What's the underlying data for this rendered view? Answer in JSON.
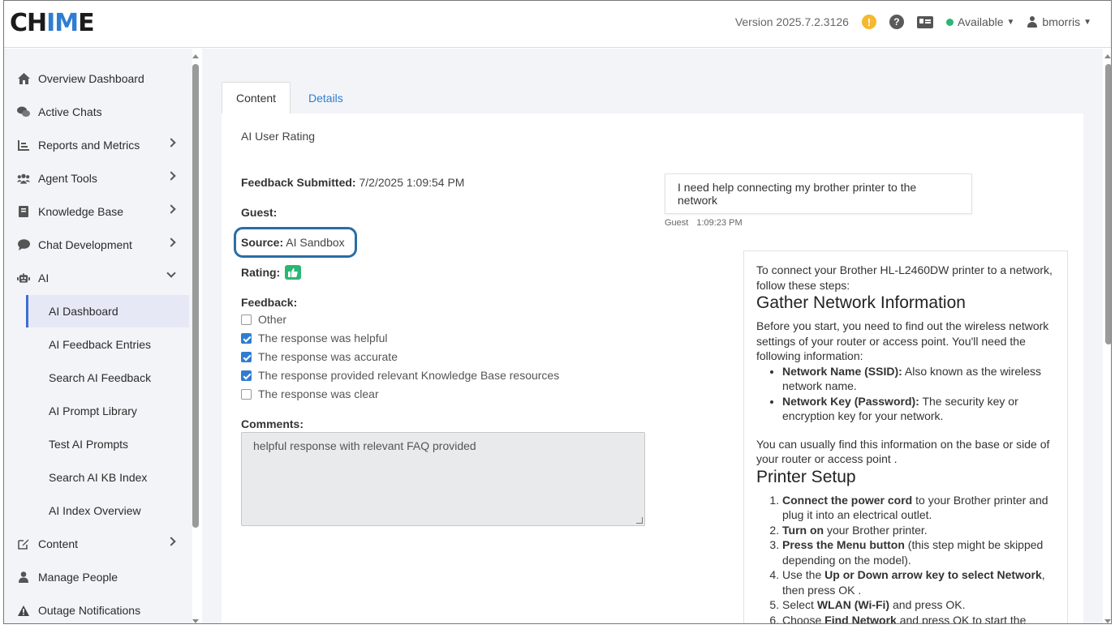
{
  "header": {
    "logo_left": "CH",
    "logo_accent": "IM",
    "logo_right": "E",
    "version": "Version 2025.7.2.3126",
    "status": "Available",
    "username": "bmorris"
  },
  "sidebar": {
    "items": [
      {
        "label": "Overview Dashboard",
        "icon": "home-icon"
      },
      {
        "label": "Active Chats",
        "icon": "chat-bubbles-icon"
      },
      {
        "label": "Reports and Metrics",
        "icon": "bar-chart-icon"
      },
      {
        "label": "Agent Tools",
        "icon": "users-icon"
      },
      {
        "label": "Knowledge Base",
        "icon": "book-icon"
      },
      {
        "label": "Chat Development",
        "icon": "comment-icon"
      },
      {
        "label": "AI",
        "icon": "robot-icon"
      }
    ],
    "ai_sub": [
      "AI Dashboard",
      "AI Feedback Entries",
      "Search AI Feedback",
      "AI Prompt Library",
      "Test AI Prompts",
      "Search AI KB Index",
      "AI Index Overview"
    ],
    "bottom_items": [
      {
        "label": "Content",
        "icon": "edit-icon"
      },
      {
        "label": "Manage People",
        "icon": "person-icon"
      },
      {
        "label": "Outage Notifications",
        "icon": "warning-icon"
      }
    ]
  },
  "tabs": {
    "content": "Content",
    "details": "Details"
  },
  "rating": {
    "section_title": "AI User Rating",
    "submitted_label": "Feedback Submitted:",
    "submitted_value": "7/2/2025 1:09:54 PM",
    "guest_label": "Guest:",
    "source_label": "Source:",
    "source_value": "AI Sandbox",
    "rating_label": "Rating:",
    "feedback_label": "Feedback:",
    "options": [
      {
        "label": "Other",
        "checked": false
      },
      {
        "label": "The response was helpful",
        "checked": true
      },
      {
        "label": "The response was accurate",
        "checked": true
      },
      {
        "label": "The response provided relevant Knowledge Base resources",
        "checked": true
      },
      {
        "label": "The response was clear",
        "checked": false
      }
    ],
    "comments_label": "Comments:",
    "comments_value": "helpful response with relevant FAQ provided"
  },
  "chat": {
    "guest_message": "I need help connecting my brother printer to the network",
    "guest_name": "Guest",
    "guest_time": "1:09:23 PM",
    "ai": {
      "intro": "To connect your Brother HL-L2460DW printer to a network, follow these steps:",
      "h1": "Gather Network Information",
      "p1": "Before you start, you need to find out the wireless network settings of your router or access point. You'll need the following information:",
      "b1_bold": "Network Name (SSID):",
      "b1_text": " Also known as the wireless network name.",
      "b2_bold": "Network Key (Password):",
      "b2_text": " The security key or encryption key for your network.",
      "p2": "You can usually find this information on the base or side of your router or access point .",
      "h2": "Printer Setup",
      "s1_bold": "Connect the power cord",
      "s1_text": " to your Brother printer and plug it into an electrical outlet.",
      "s2_bold": "Turn on",
      "s2_text": " your Brother printer.",
      "s3_bold": "Press the Menu button",
      "s3_text": " (this step might be skipped depending on the model).",
      "s4_pre": "Use the ",
      "s4_bold": "Up or Down arrow key to select Network",
      "s4_text": ", then press OK .",
      "s5_pre": "Select ",
      "s5_bold": "WLAN (Wi-Fi)",
      "s5_text": " and press OK.",
      "s6_pre": "Choose ",
      "s6_bold": "Find Network",
      "s6_text": " and press OK to start the"
    }
  },
  "colors": {
    "accent": "#2f7dd1",
    "available": "#2bb673",
    "warning": "#f5b82e",
    "highlight": "#2a6ea3"
  }
}
